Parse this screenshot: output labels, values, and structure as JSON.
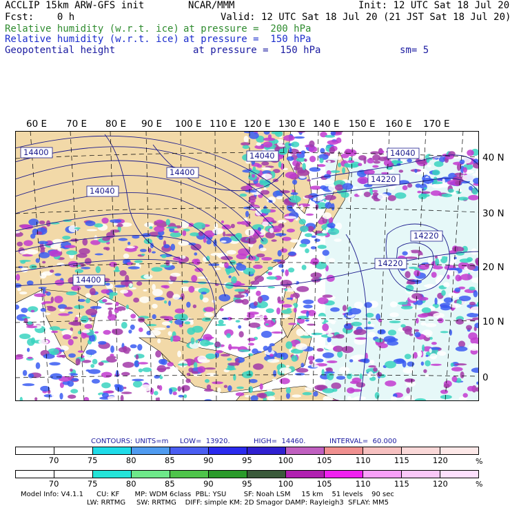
{
  "header": {
    "model_title": "ACCLIP 15km ARW-GFS init",
    "center": "NCAR/MMM",
    "init": "Init: 12 UTC Sat 18 Jul 20",
    "fcst": "Fcst:    0 h",
    "valid": "Valid: 12 UTC Sat 18 Jul 20 (21 JST Sat 18 Jul 20)",
    "line1_field": "Relative humidity (w.r.t. ice)",
    "line1_level": "at pressure =  200 hPa",
    "line2_field": "Relative humidity (w.r.t. ice)",
    "line2_level": "at pressure =  150 hPa",
    "line3_field": "Geopotential height",
    "line3_level": "at pressure =  150 hPa",
    "smoothing": "sm= 5"
  },
  "map": {
    "lon_labels": [
      "60 E",
      "70 E",
      "80 E",
      "90 E",
      "100 E",
      "110 E",
      "120 E",
      "130 E",
      "140 E",
      "150 E",
      "160 E",
      "170 E"
    ],
    "lat_labels": [
      "40 N",
      "30 N",
      "20 N",
      "10 N",
      "0"
    ],
    "contour_labels": [
      "14400",
      "14040",
      "14400",
      "14400",
      "14040",
      "14040",
      "14220",
      "14220",
      "14220"
    ],
    "colors": {
      "land": "#f2d9a8",
      "rh_200_low": "#3ad4c0",
      "rh_200_high": "#a23aa8",
      "rh_150_low": "#3a5cf2",
      "rh_150_high": "#c23ad0",
      "contour": "#1a1a8c"
    }
  },
  "contour_info": {
    "contours": "CONTOURS:",
    "units": "UNITS=m",
    "low": "LOW=  13920.",
    "high": "HIGH=  14460.",
    "interval": "INTERVAL=  60.000"
  },
  "colorbar1": {
    "labels": [
      "70",
      "75",
      "80",
      "85",
      "90",
      "95",
      "100",
      "105",
      "110",
      "115",
      "120"
    ],
    "unit": "%",
    "colors": [
      "#ffffff",
      "#ffffff",
      "#1fdbe8",
      "#4f9bf0",
      "#4a5ef2",
      "#2a2aee",
      "#3020d0",
      "#c060c0",
      "#f09090",
      "#f6c0c0",
      "#fad8d8",
      "#fde8e8"
    ]
  },
  "colorbar2": {
    "labels": [
      "70",
      "75",
      "80",
      "85",
      "90",
      "95",
      "100",
      "105",
      "110",
      "115",
      "120"
    ],
    "unit": "%",
    "colors": [
      "#ffffff",
      "#ffffff",
      "#24e4d8",
      "#6ee88a",
      "#4ec44a",
      "#2a9a2a",
      "#3a5a3a",
      "#b020b0",
      "#f020f0",
      "#f8a0f8",
      "#fac8f8",
      "#fde0fd"
    ]
  },
  "footer": {
    "line1": "Model Info: V4.1.1      CU: KF       MP: WDM 6class  PBL: YSU        SF: Noah LSM     15 km    51 levels    90 sec",
    "line2": "LW: RRTMG     SW: RRTMG    DIFF: simple KM: 2D Smagor DAMP: Rayleigh3  SFLAY: MM5"
  }
}
